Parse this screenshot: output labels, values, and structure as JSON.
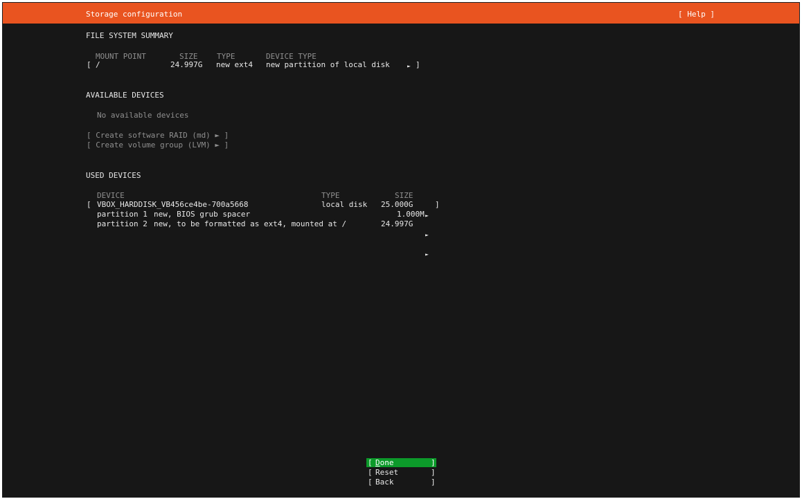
{
  "header": {
    "title": "Storage configuration",
    "help": "[ Help ]",
    "accent": "#e95420"
  },
  "fs_summary": {
    "heading": "FILE SYSTEM SUMMARY",
    "columns": [
      "MOUNT POINT",
      "SIZE",
      "TYPE",
      "DEVICE TYPE"
    ],
    "rows": [
      {
        "bracket_open": "[",
        "mount": "/",
        "size": "24.997G",
        "type": "new ext4",
        "device_type": "new partition of local disk",
        "arrow": "►",
        "bracket_close": "]"
      }
    ]
  },
  "available": {
    "heading": "AVAILABLE DEVICES",
    "empty": "No available devices",
    "actions": [
      {
        "label": "[ Create software RAID (md) ► ]"
      },
      {
        "label": "[ Create volume group (LVM) ► ]"
      }
    ]
  },
  "used": {
    "heading": "USED DEVICES",
    "columns": [
      "DEVICE",
      "TYPE",
      "SIZE"
    ],
    "disk": {
      "bracket_open": "[",
      "name": "VBOX_HARDDISK_VB456ce4be-700a5668",
      "type": "local disk",
      "size": "25.000G",
      "arrow": "►",
      "bracket_close": "]"
    },
    "partitions": [
      {
        "name": "partition 1",
        "desc": "new, BIOS grub spacer",
        "size": "1.000M",
        "arrow": "►"
      },
      {
        "name": "partition 2",
        "desc": "new, to be formatted as ext4, mounted at /",
        "size": "24.997G",
        "arrow": "►"
      }
    ]
  },
  "buttons": {
    "done": {
      "open": "[",
      "mnemonic": "D",
      "rest": "one",
      "close": "]",
      "selected": true,
      "highlight": "#0c9a2a"
    },
    "reset": {
      "open": "[",
      "label": "Reset",
      "close": "]"
    },
    "back": {
      "open": "[",
      "label": "Back",
      "close": "]"
    }
  }
}
